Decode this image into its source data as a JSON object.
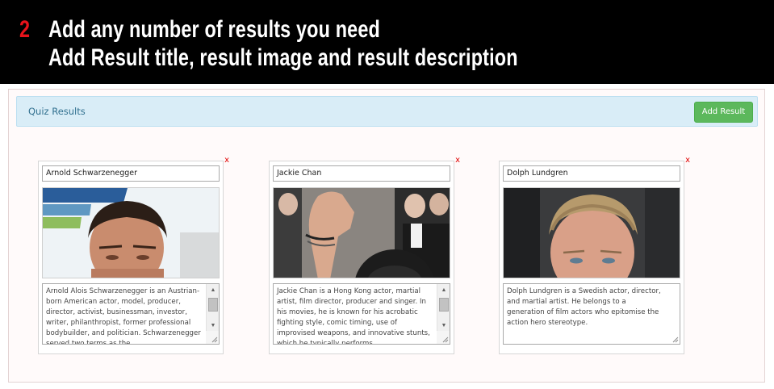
{
  "banner": {
    "step_number": "2",
    "line1": "Add any number of results you need",
    "line2": "Add Result title, result image and result description"
  },
  "panel": {
    "title": "Quiz Results",
    "add_button_label": "Add Result"
  },
  "results": [
    {
      "title": "Arnold Schwarzenegger",
      "remove_label": "x",
      "image_subject": "portrait photo of Arnold Schwarzenegger",
      "description": "Arnold Alois Schwarzenegger is an Austrian-born American actor, model, producer, director, activist, businessman, investor, writer, philanthropist, former professional bodybuilder, and politician. Schwarzenegger served two terms as the"
    },
    {
      "title": "Jackie Chan",
      "remove_label": "x",
      "image_subject": "photo of Jackie Chan waving",
      "description": "Jackie Chan  is a Hong Kong actor, martial artist, film director, producer and singer. In his movies, he is known for his acrobatic fighting style, comic timing, use of improvised weapons, and innovative stunts, which he typically performs"
    },
    {
      "title": "Dolph Lundgren",
      "remove_label": "x",
      "image_subject": "portrait photo of Dolph Lundgren",
      "description": "Dolph Lundgren  is a Swedish actor, director, and martial artist. He belongs to a generation of film actors who epitomise the action hero stereotype."
    }
  ],
  "colors": {
    "banner_bg": "#000000",
    "step_number": "#e8131b",
    "panel_header_bg": "#d9edf7",
    "panel_title": "#31708f",
    "add_button_bg": "#5cb85c",
    "remove_x": "#e00000"
  },
  "icons": {
    "remove": "close-icon",
    "scroll_up": "scroll-up-arrow-icon",
    "scroll_down": "scroll-down-arrow-icon",
    "resize": "resize-grip-icon"
  }
}
